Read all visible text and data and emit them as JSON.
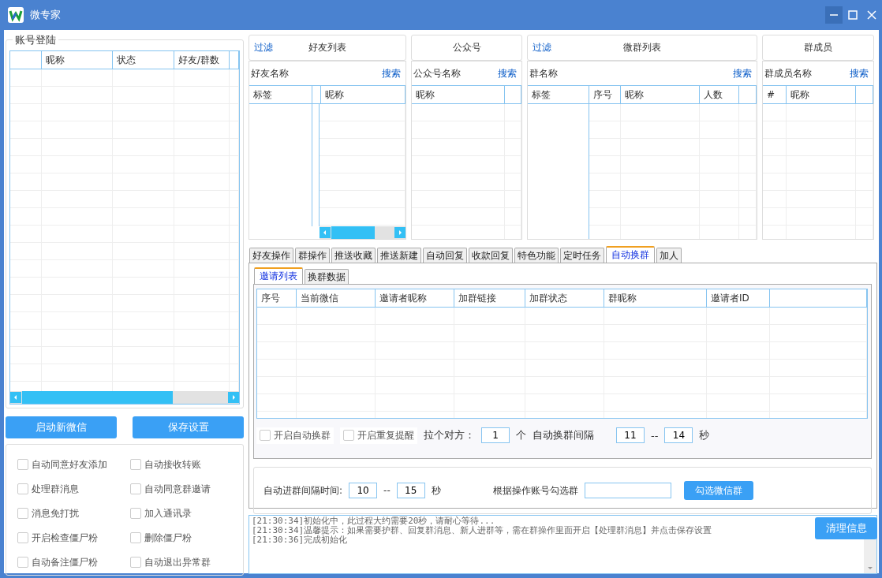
{
  "window": {
    "title": "微专家"
  },
  "account_panel": {
    "title": "账号登陆",
    "columns": [
      "昵称",
      "状态",
      "好友/群数"
    ]
  },
  "buttons": [
    "启动新微信",
    "保存设置"
  ],
  "options": [
    {
      "label": "自动同意好友添加",
      "checked": false
    },
    {
      "label": "自动接收转账",
      "checked": false
    },
    {
      "label": "处理群消息",
      "checked": false
    },
    {
      "label": "自动同意群邀请",
      "checked": false
    },
    {
      "label": "消息免打扰",
      "checked": false
    },
    {
      "label": "加入通讯录",
      "checked": false
    },
    {
      "label": "开启检查僵尸粉",
      "checked": false
    },
    {
      "label": "删除僵尸粉",
      "checked": false
    },
    {
      "label": "自动备注僵尸粉",
      "checked": false
    },
    {
      "label": "自动退出异常群",
      "checked": false
    }
  ],
  "panels": [
    {
      "filter": "过滤",
      "title": "好友列表",
      "search_label": "好友名称",
      "search": "搜索",
      "columns": [
        "标签",
        "昵称"
      ]
    },
    {
      "title": "公众号",
      "search_label": "公众号名称",
      "search": "搜索",
      "columns": [
        "昵称"
      ]
    },
    {
      "filter": "过滤",
      "title": "微群列表",
      "search_label": "群名称",
      "search": "搜索",
      "columns": [
        "标签",
        "序号",
        "昵称",
        "人数"
      ]
    },
    {
      "title": "群成员",
      "search_label": "群成员名称",
      "search": "搜索",
      "columns": [
        "#",
        "昵称"
      ]
    }
  ],
  "tabs": [
    {
      "label": "好友操作",
      "selected": false
    },
    {
      "label": "群操作",
      "selected": false
    },
    {
      "label": "推送收藏",
      "selected": false
    },
    {
      "label": "推送新建",
      "selected": false
    },
    {
      "label": "自动回复",
      "selected": false
    },
    {
      "label": "收款回复",
      "selected": false
    },
    {
      "label": "特色功能",
      "selected": false
    },
    {
      "label": "定时任务",
      "selected": false
    },
    {
      "label": "自动换群",
      "selected": true
    },
    {
      "label": "加人",
      "selected": false
    }
  ],
  "subtabs": [
    {
      "label": "邀请列表",
      "selected": true
    },
    {
      "label": "换群数据",
      "selected": false
    }
  ],
  "invite_table": {
    "columns": [
      "序号",
      "当前微信",
      "邀请者昵称",
      "加群链接",
      "加群状态",
      "群昵称",
      "邀请者ID"
    ]
  },
  "switch_options": [
    {
      "label": "开启自动换群",
      "checked": false
    },
    {
      "label": "开启重复提醒",
      "checked": false
    }
  ],
  "pull_label": "拉个对方：",
  "pull_count": "1",
  "pull_unit": "个",
  "interval_label": "自动换群间隔",
  "interval_from": "11",
  "interval_sep": "--",
  "interval_to": "14",
  "interval_unit": "秒",
  "join_label": "自动进群间隔时间:",
  "join_from": "10",
  "join_sep": "--",
  "join_to": "15",
  "join_unit": "秒",
  "select_label": "根据操作账号勾选群",
  "select_button": "勾选微信群",
  "log": [
    "[21:30:34]初始化中，此过程大约需要20秒，请耐心等待...",
    "[21:30:34]温馨提示：如果需要护群、回复群消息、新人进群等，需在群操作里面开启【处理群消息】并点击保存设置",
    "[21:30:36]完成初始化"
  ],
  "clear_button": "清理信息"
}
